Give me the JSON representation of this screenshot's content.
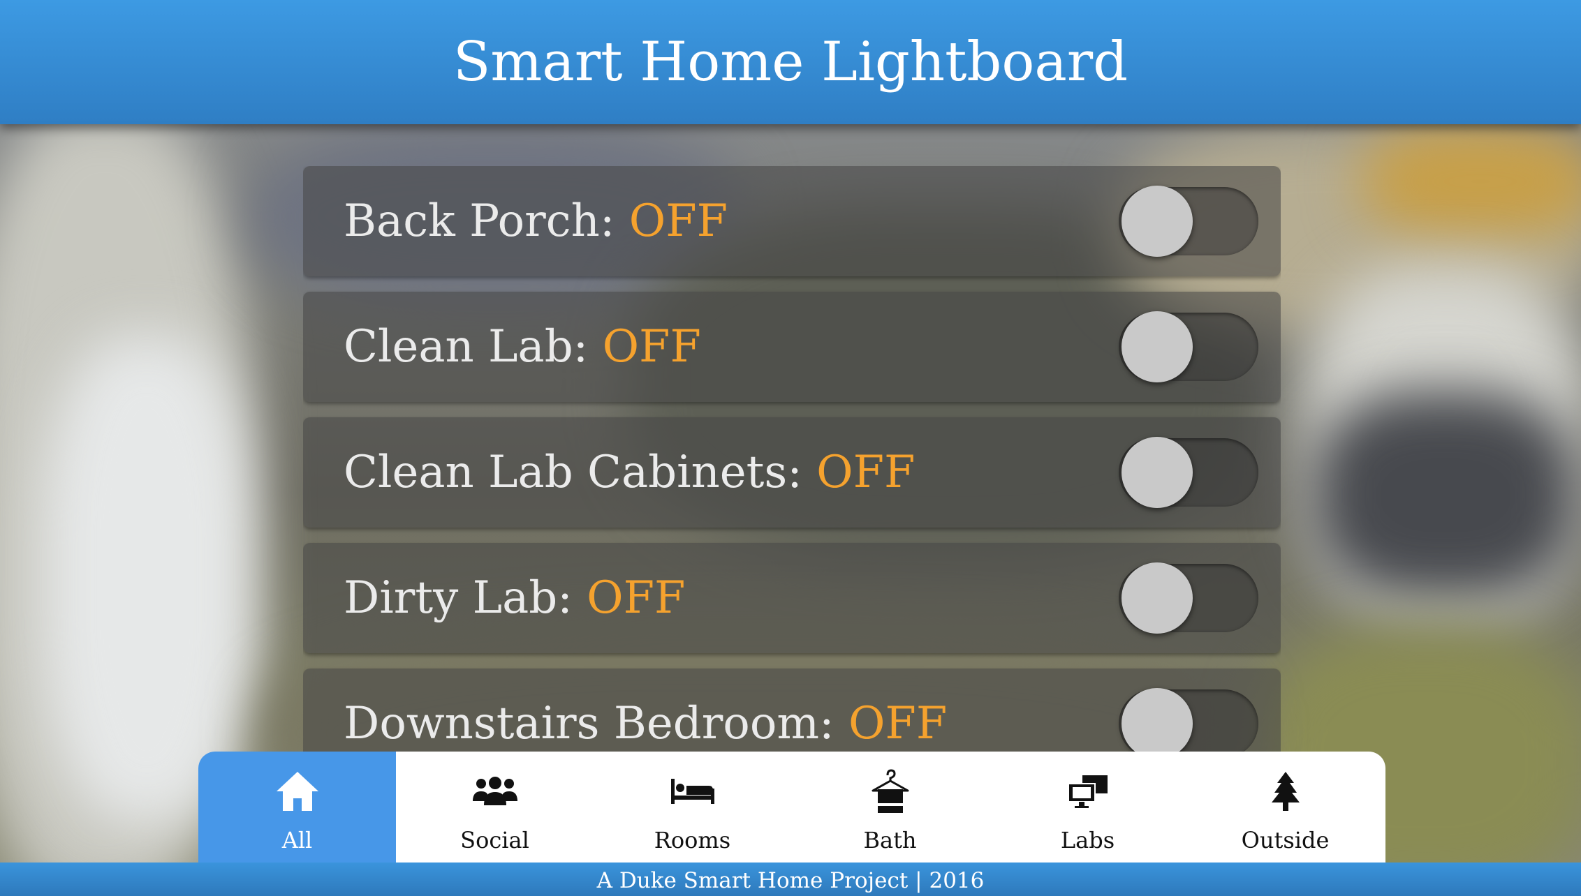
{
  "header": {
    "title": "Smart Home Lightboard"
  },
  "lights": [
    {
      "name": "Back Porch:",
      "state": "OFF"
    },
    {
      "name": "Clean Lab:",
      "state": "OFF"
    },
    {
      "name": "Clean Lab Cabinets:",
      "state": "OFF"
    },
    {
      "name": "Dirty Lab:",
      "state": "OFF"
    },
    {
      "name": "Downstairs Bedroom:",
      "state": "OFF"
    }
  ],
  "nav": {
    "items": [
      {
        "label": "All",
        "icon": "home-icon",
        "active": true
      },
      {
        "label": "Social",
        "icon": "people-icon",
        "active": false
      },
      {
        "label": "Rooms",
        "icon": "bed-icon",
        "active": false
      },
      {
        "label": "Bath",
        "icon": "towel-hanger-icon",
        "active": false
      },
      {
        "label": "Labs",
        "icon": "computers-icon",
        "active": false
      },
      {
        "label": "Outside",
        "icon": "tree-icon",
        "active": false
      }
    ]
  },
  "footer": {
    "text": "A Duke Smart Home Project | 2016"
  },
  "colors": {
    "header_blue": "#3d9ae3",
    "state_off": "#f5a22e",
    "nav_active": "#4797e8"
  }
}
